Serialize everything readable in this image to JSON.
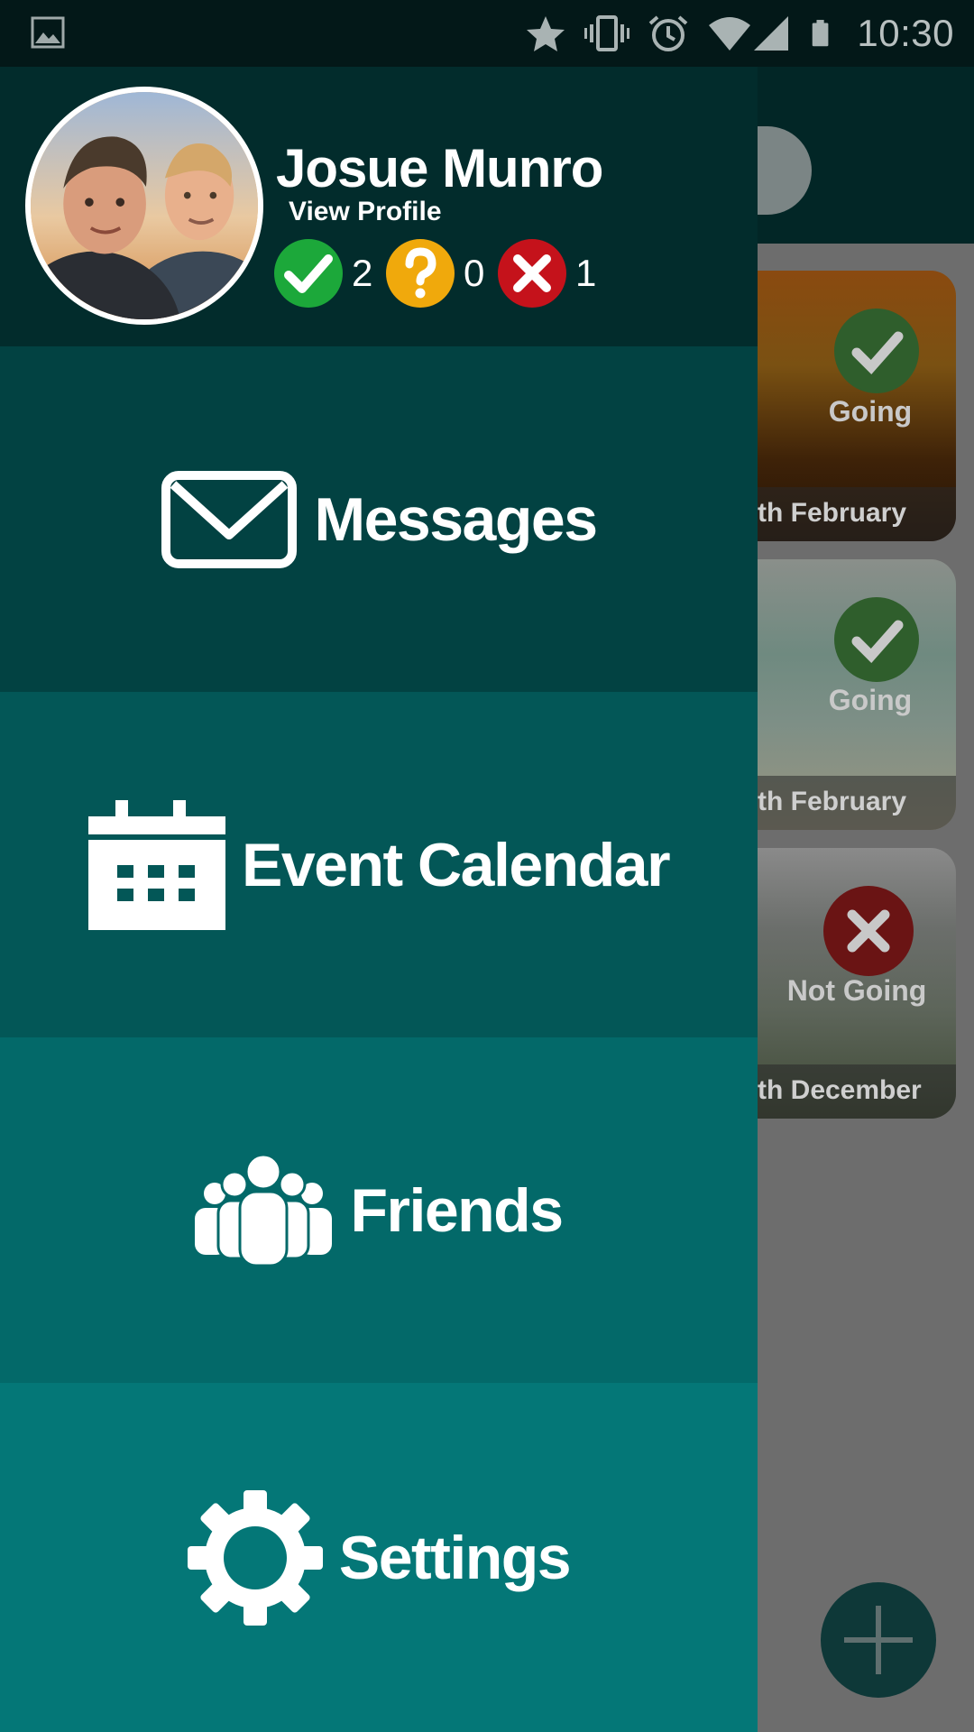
{
  "status_bar": {
    "time": "10:30",
    "icons": [
      "image-icon",
      "star-icon",
      "vibrate-icon",
      "alarm-icon",
      "wifi-icon",
      "signal-icon",
      "battery-icon"
    ]
  },
  "drawer": {
    "user": {
      "name": "Josue Munro",
      "view_profile_label": "View Profile"
    },
    "counters": [
      {
        "icon": "check-icon",
        "color": "#1ca83a",
        "count": "2"
      },
      {
        "icon": "question-icon",
        "color": "#f0a90c",
        "count": "0"
      },
      {
        "icon": "cross-icon",
        "color": "#c5121b",
        "count": "1"
      }
    ],
    "menu": [
      {
        "label": "Messages",
        "icon": "envelope-icon",
        "color": "#024242"
      },
      {
        "label": "Event Calendar",
        "icon": "calendar-icon",
        "color": "#035757"
      },
      {
        "label": "Friends",
        "icon": "people-icon",
        "color": "#036969"
      },
      {
        "label": "Settings",
        "icon": "gear-icon",
        "color": "#047777"
      }
    ]
  },
  "background_app": {
    "events": [
      {
        "date": "th February",
        "status": "Going",
        "status_icon": "check-icon"
      },
      {
        "date": "th February",
        "status": "Going",
        "status_icon": "check-icon"
      },
      {
        "date": "th December",
        "status": "Not Going",
        "status_icon": "cross-icon"
      }
    ],
    "fab_icon": "plus-icon"
  }
}
